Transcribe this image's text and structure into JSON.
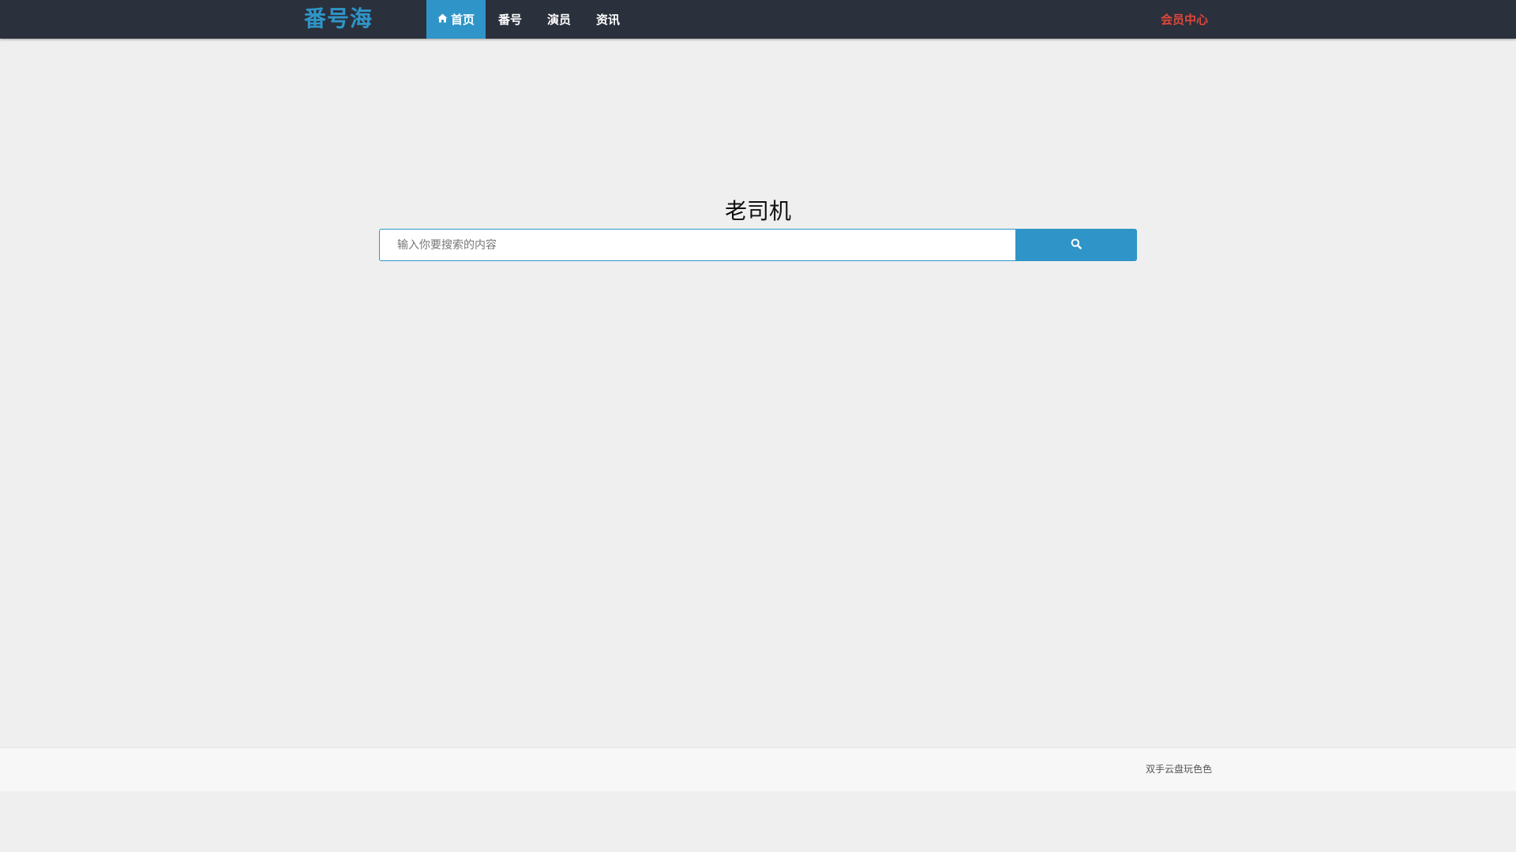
{
  "header": {
    "brand": "番号海",
    "nav": [
      {
        "label": "首页",
        "active": true,
        "icon": "home-icon"
      },
      {
        "label": "番号",
        "active": false
      },
      {
        "label": "演员",
        "active": false
      },
      {
        "label": "资讯",
        "active": false
      }
    ],
    "member_link": "会员中心"
  },
  "main": {
    "title": "老司机",
    "search": {
      "placeholder": "输入你要搜索的内容",
      "value": "",
      "button_icon": "search-icon"
    }
  },
  "footer": {
    "text": "双手云盘玩色色"
  },
  "colors": {
    "navbar_bg": "#2a303c",
    "accent": "#2f95c8",
    "member_link": "#e0463a",
    "page_bg": "#efefef"
  }
}
